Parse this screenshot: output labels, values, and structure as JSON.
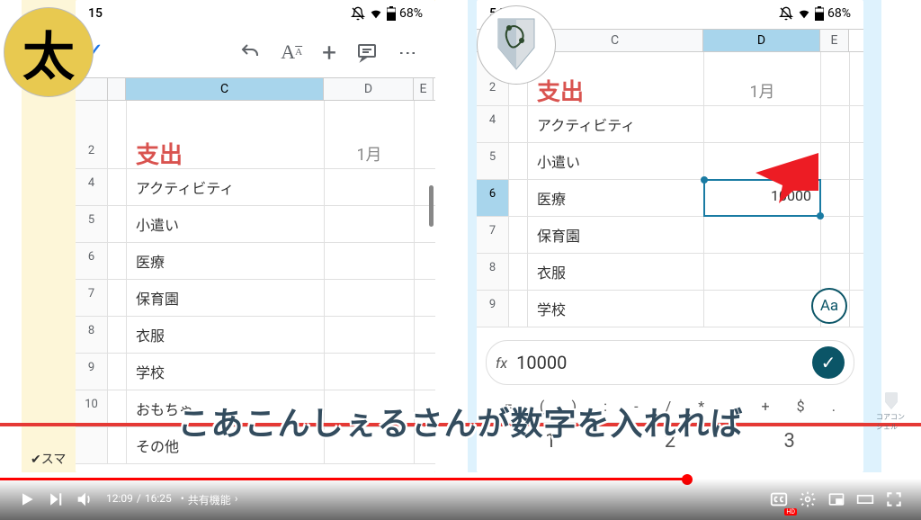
{
  "status": {
    "time_left": "15",
    "time_right": "54",
    "battery": "68%"
  },
  "toolbar": {
    "check": "✓"
  },
  "sheet": {
    "title": "支出",
    "month": "1月",
    "cols_left": {
      "b_w": 20,
      "c_w": 220,
      "d_w": 130,
      "e_w": 20
    },
    "cols_right": {
      "b_w": 20,
      "c_w": 196,
      "d_w": 130,
      "e_w": 32
    },
    "rows_left": [
      {
        "n": "4",
        "c": "アクティビティ"
      },
      {
        "n": "5",
        "c": "小遣い"
      },
      {
        "n": "6",
        "c": "医療"
      },
      {
        "n": "7",
        "c": "保育園"
      },
      {
        "n": "8",
        "c": "衣服"
      },
      {
        "n": "9",
        "c": "学校"
      },
      {
        "n": "10",
        "c": "おもちゃ"
      },
      {
        "n": "",
        "c": "その他"
      }
    ],
    "rows_right": [
      {
        "n": "4",
        "c": "アクティビティ"
      },
      {
        "n": "5",
        "c": "小遣い"
      },
      {
        "n": "6",
        "c": "医療",
        "d": "10000",
        "active": true
      },
      {
        "n": "7",
        "c": "保育園"
      },
      {
        "n": "8",
        "c": "衣服"
      },
      {
        "n": "9",
        "c": "学校"
      }
    ]
  },
  "fx": {
    "label": "fx",
    "value": "10000"
  },
  "symbols": [
    "=",
    "(",
    ")",
    ":",
    "-",
    "/",
    "*",
    ",",
    "+",
    "$",
    "."
  ],
  "numbers": [
    "1",
    "2",
    "3"
  ],
  "aa": "Aa",
  "caption": "こあこんしぇるさんが数字を入れれば",
  "avatar_left": "太",
  "player": {
    "current": "12:09",
    "sep": "/",
    "total": "16:25",
    "chapter_pre": "•",
    "chapter": "共有機能",
    "chev": "›"
  },
  "cc_badge": "HD",
  "watermark_text": "スマ",
  "logo_label": "コアコンシェル"
}
